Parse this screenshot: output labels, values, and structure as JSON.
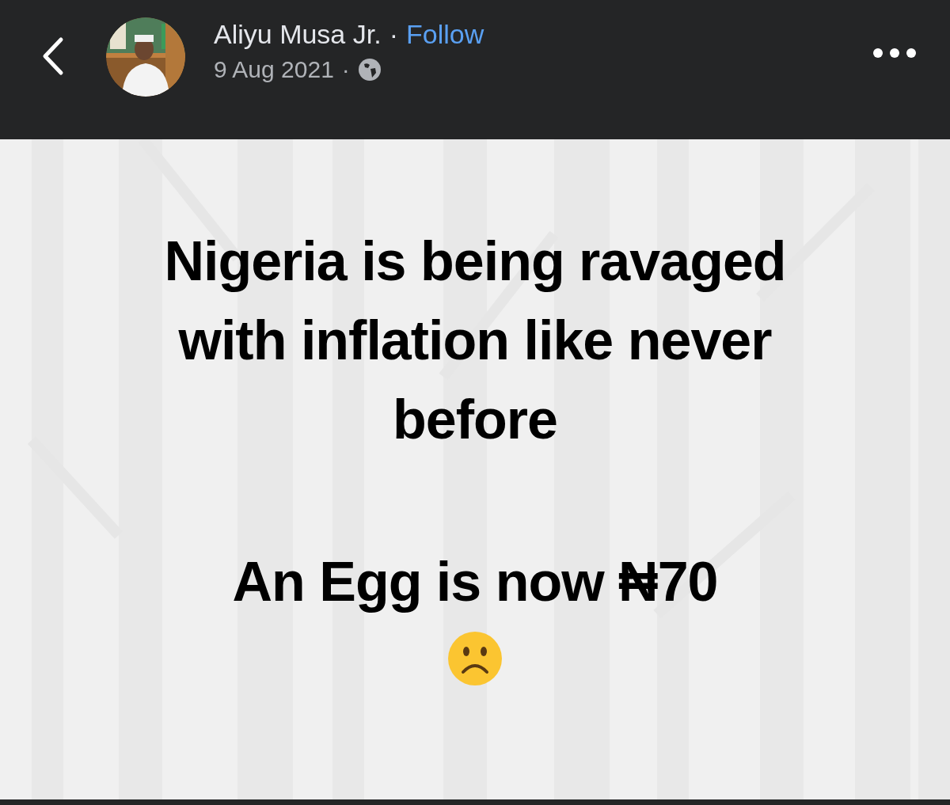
{
  "header": {
    "author": "Aliyu Musa Jr.",
    "separator": "·",
    "follow": "Follow",
    "date": "9 Aug 2021",
    "date_separator": "·"
  },
  "post": {
    "paragraphs": [
      "Nigeria is being ravaged with inflation like never before",
      "An Egg is now ₦70"
    ]
  }
}
